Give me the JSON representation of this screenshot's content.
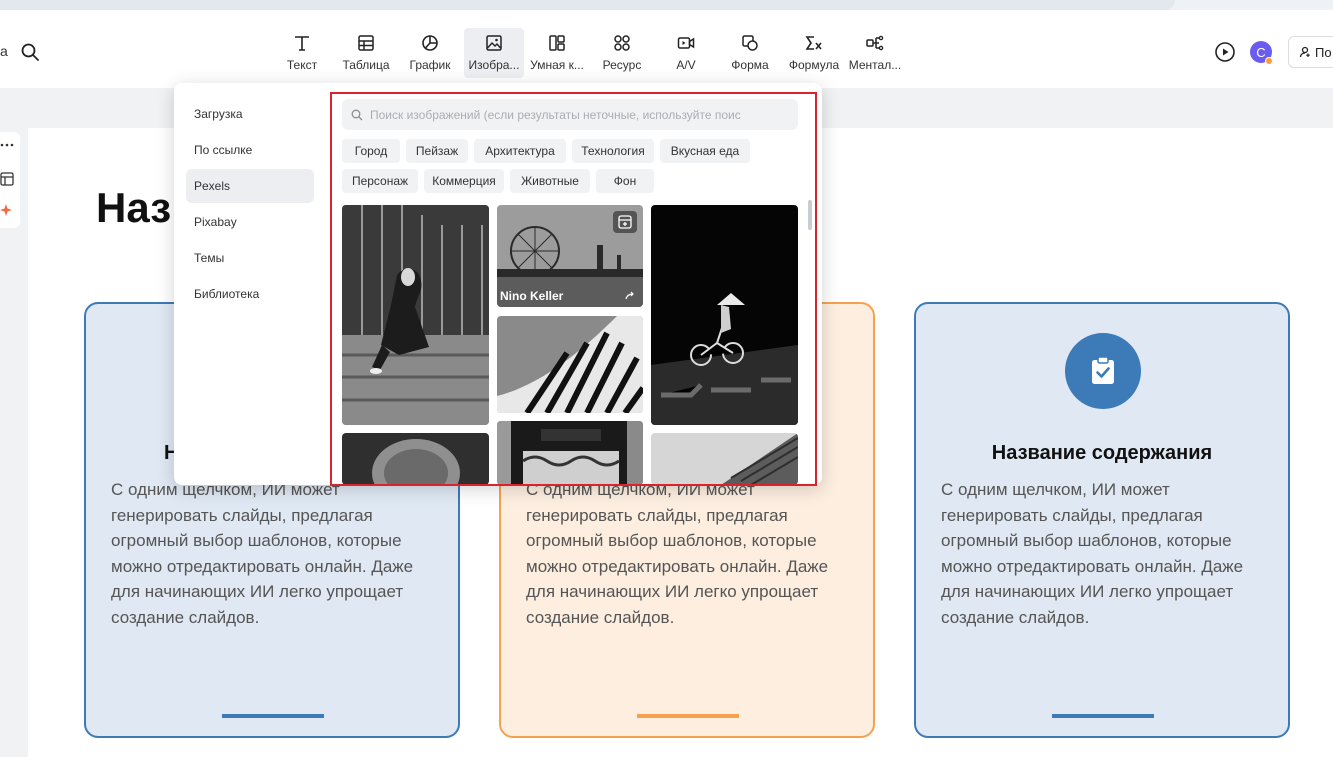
{
  "toolbar": {
    "left_fragment": "a",
    "tools": [
      {
        "label": "Текст",
        "icon": "text-icon",
        "active": false
      },
      {
        "label": "Таблица",
        "icon": "table-icon",
        "active": false
      },
      {
        "label": "График",
        "icon": "chart-icon",
        "active": false
      },
      {
        "label": "Изобра...",
        "icon": "image-icon",
        "active": true
      },
      {
        "label": "Умная к...",
        "icon": "smart-layout-icon",
        "active": false
      },
      {
        "label": "Ресурс",
        "icon": "resource-icon",
        "active": false
      },
      {
        "label": "A/V",
        "icon": "video-icon",
        "active": false
      },
      {
        "label": "Форма",
        "icon": "shape-icon",
        "active": false
      },
      {
        "label": "Формула",
        "icon": "formula-icon",
        "active": false
      },
      {
        "label": "Ментал...",
        "icon": "mindmap-icon",
        "active": false
      }
    ],
    "avatar_letter": "C",
    "share_label": "По"
  },
  "slide": {
    "title": "Наз",
    "cards": [
      {
        "title": "Н",
        "body": "С одним щелчком, ИИ может генерировать слайды, предлагая огромный выбор шаблонов, которые можно отредактировать онлайн. Даже для начинающих ИИ легко упрощает создание слайдов."
      },
      {
        "title": "",
        "body": "С одним щелчком, ИИ может генерировать слайды, предлагая огромный выбор шаблонов, которые можно отредактировать онлайн. Даже для начинающих ИИ легко упрощает создание слайдов."
      },
      {
        "title": "Название содержания",
        "body": "С одним щелчком, ИИ может генерировать слайды, предлагая огромный выбор шаблонов, которые можно отредактировать онлайн. Даже для начинающих ИИ легко упрощает создание слайдов."
      }
    ]
  },
  "popup": {
    "nav": [
      {
        "label": "Загрузка",
        "active": false
      },
      {
        "label": "По ссылке",
        "active": false
      },
      {
        "label": "Pexels",
        "active": true
      },
      {
        "label": "Pixabay",
        "active": false
      },
      {
        "label": "Темы",
        "active": false
      },
      {
        "label": "Библиотека",
        "active": false
      }
    ],
    "search_placeholder": "Поиск изображений (если результаты неточные, используйте поис",
    "search_value": "",
    "chips": [
      "Город",
      "Пейзаж",
      "Архитектура",
      "Технология",
      "Вкусная еда",
      "Персонаж",
      "Коммерция",
      "Животные",
      "Фон"
    ],
    "hover_caption": "Nino Keller"
  },
  "colors": {
    "accent_blue": "#3c7ab8",
    "accent_orange": "#f5a24e",
    "highlight_red": "#d9232d",
    "avatar": "#6a5cf0"
  }
}
